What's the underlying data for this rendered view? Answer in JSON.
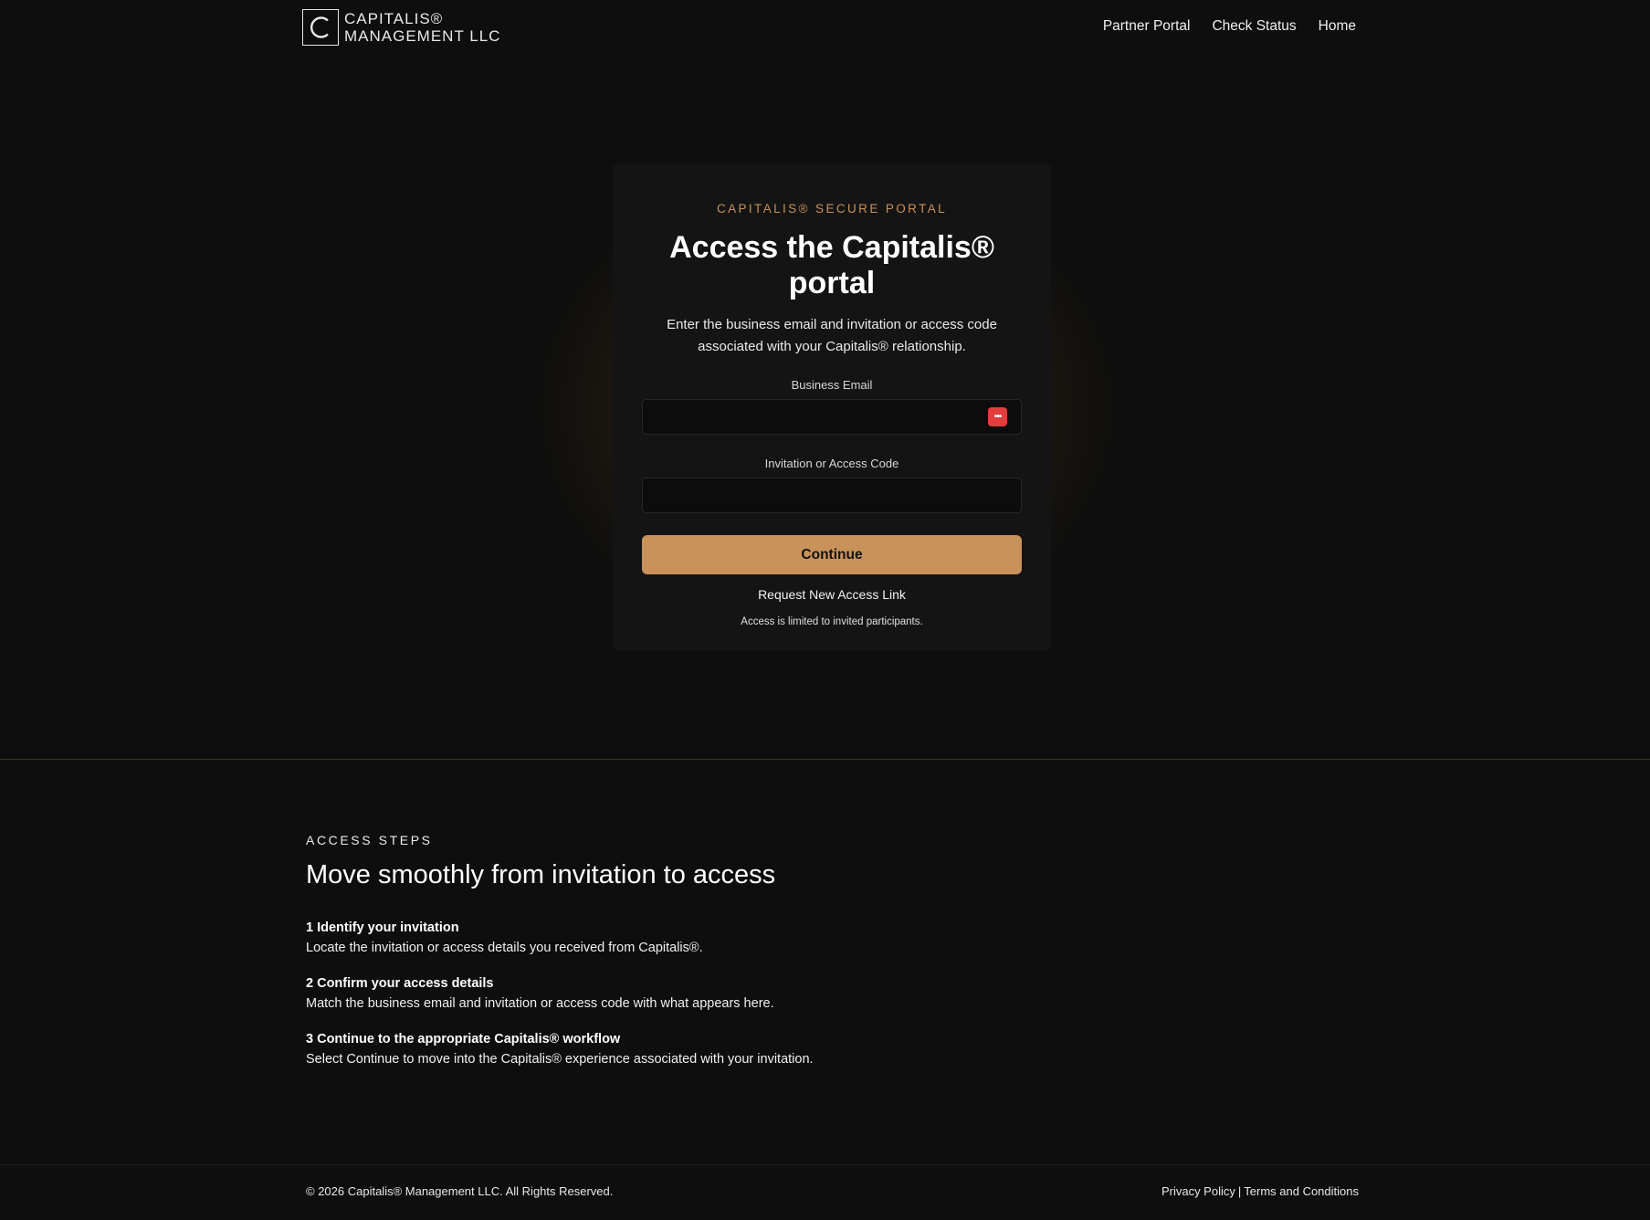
{
  "header": {
    "logo_line1": "CAPITALIS®",
    "logo_line2": "MANAGEMENT LLC",
    "nav": [
      "Partner Portal",
      "Check Status",
      "Home"
    ]
  },
  "portal": {
    "eyebrow": "CAPITALIS® SECURE PORTAL",
    "title": "Access the Capitalis® portal",
    "description": "Enter the business email and invitation or access code associated with your Capitalis® relationship.",
    "email_label": "Business Email",
    "email_value": "",
    "code_label": "Invitation or Access Code",
    "code_value": "",
    "continue_label": "Continue",
    "request_link": "Request New Access Link",
    "fine_print": "Access is limited to invited participants."
  },
  "steps": {
    "eyebrow": "ACCESS STEPS",
    "title": "Move smoothly from invitation to access",
    "items": [
      {
        "title": "1 Identify your invitation",
        "text": "Locate the invitation or access details you received from Capitalis®."
      },
      {
        "title": "2 Confirm your access details",
        "text": "Match the business email and invitation or access code with what appears here."
      },
      {
        "title": "3 Continue to the appropriate Capitalis® workflow",
        "text": "Select Continue to move into the Capitalis® experience associated with your invitation."
      }
    ]
  },
  "footer": {
    "copyright": "© 2026 Capitalis® Management LLC. All Rights Reserved.",
    "privacy": "Privacy Policy",
    "separator": "|",
    "terms": "Terms and Conditions"
  },
  "colors": {
    "background": "#0e0e0e",
    "card": "#141414",
    "accent": "#c9925b",
    "eyebrow": "#c9905a",
    "password_icon": "#e23c3c"
  },
  "icons": {
    "logo": "capital-c-logo-icon",
    "password_manager": "password-manager-icon"
  }
}
